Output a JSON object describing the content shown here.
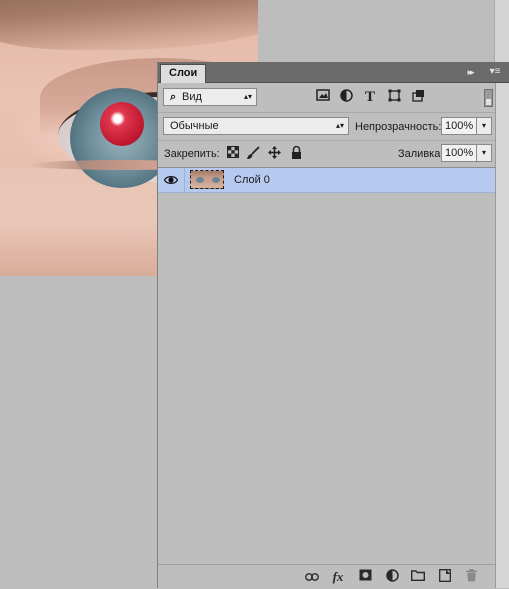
{
  "panel": {
    "tab_label": "Слои",
    "collapse_glyph": "▸▸",
    "menu_glyph": "▾≡"
  },
  "filter": {
    "kind_label": "Вид",
    "icons": [
      "image-filter-icon",
      "adjustment-filter-icon",
      "type-filter-icon",
      "shape-filter-icon",
      "smart-object-filter-icon"
    ]
  },
  "blend": {
    "mode": "Обычные",
    "opacity_label": "Непрозрачность:",
    "opacity_value": "100%"
  },
  "lock": {
    "label": "Закрепить:",
    "icons": [
      "lock-transparent-icon",
      "lock-pixels-icon",
      "lock-position-icon",
      "lock-all-icon"
    ],
    "fill_label": "Заливка:",
    "fill_value": "100%"
  },
  "layers": [
    {
      "name": "Слой 0",
      "visible": true,
      "selected": true
    }
  ],
  "footer": {
    "icons": [
      "link-icon",
      "fx-icon",
      "mask-icon",
      "adjustment-layer-icon",
      "group-folder-icon",
      "new-layer-icon",
      "trash-icon"
    ],
    "fx_label": "fx"
  },
  "colors": {
    "selected_row": "#b6c9ef",
    "pupil_red": "#c51b34"
  }
}
